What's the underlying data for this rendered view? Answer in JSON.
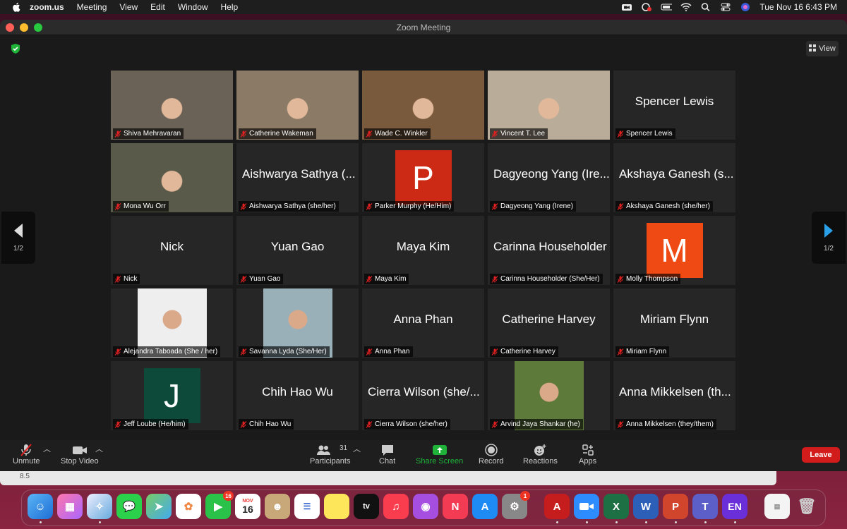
{
  "menubar": {
    "app": "zoom.us",
    "items": [
      "Meeting",
      "View",
      "Edit",
      "Window",
      "Help"
    ],
    "clock": "Tue Nov 16  6:43 PM"
  },
  "window": {
    "title": "Zoom Meeting",
    "view_label": "View",
    "page_indicator_left": "1/2",
    "page_indicator_right": "1/2"
  },
  "tiles": [
    {
      "name": "Shiva Mehravaran",
      "mode": "video",
      "scene": "room-1"
    },
    {
      "name": "Catherine Wakeman",
      "mode": "video",
      "scene": "room-2"
    },
    {
      "name": "Wade C. Winkler",
      "mode": "video",
      "scene": "room-3"
    },
    {
      "name": "Vincent T. Lee",
      "mode": "video",
      "scene": "room-4",
      "active": true
    },
    {
      "name": "Spencer Lewis",
      "display": "Spencer Lewis",
      "mode": "name"
    },
    {
      "name": "Mona Wu Orr",
      "mode": "video",
      "scene": "room-5"
    },
    {
      "name": "Aishwarya Sathya (she/her)",
      "display": "Aishwarya Sathya (...",
      "mode": "name"
    },
    {
      "name": "Parker Murphy  (He/Him)",
      "mode": "avatar",
      "initial": "P",
      "color": "#cc2a14"
    },
    {
      "name": "Dagyeong Yang (Irene)",
      "display": "Dagyeong Yang (Ire...",
      "mode": "name"
    },
    {
      "name": "Akshaya Ganesh (she/her)",
      "display": "Akshaya Ganesh (s...",
      "mode": "name"
    },
    {
      "name": "Nick",
      "display": "Nick",
      "mode": "name"
    },
    {
      "name": "Yuan Gao",
      "display": "Yuan Gao",
      "mode": "name"
    },
    {
      "name": "Maya Kim",
      "display": "Maya Kim",
      "mode": "name"
    },
    {
      "name": "Carinna Householder  (She/Her)",
      "display": "Carinna Householder",
      "mode": "name"
    },
    {
      "name": "Molly Thompson",
      "mode": "avatar",
      "initial": "M",
      "color": "#f04a14"
    },
    {
      "name": "Alejandra Taboada (She / her)",
      "mode": "photo",
      "scene": "photo-1"
    },
    {
      "name": "Savanna Lyda (She/Her)",
      "mode": "photo",
      "scene": "photo-2"
    },
    {
      "name": "Anna Phan",
      "display": "Anna Phan",
      "mode": "name"
    },
    {
      "name": "Catherine Harvey",
      "display": "Catherine Harvey",
      "mode": "name"
    },
    {
      "name": "Miriam Flynn",
      "display": "Miriam Flynn",
      "mode": "name"
    },
    {
      "name": "Jeff Loube  (He/him)",
      "mode": "avatar",
      "initial": "J",
      "color": "#0e4a3a"
    },
    {
      "name": "Chih Hao Wu",
      "display": "Chih Hao Wu",
      "mode": "name"
    },
    {
      "name": "Cierra Wilson (she/her)",
      "display": "Cierra Wilson (she/...",
      "mode": "name"
    },
    {
      "name": "Arvind Jaya Shankar  (he)",
      "mode": "photo",
      "scene": "photo-3"
    },
    {
      "name": "Anna Mikkelsen (they/them)",
      "display": "Anna Mikkelsen (th...",
      "mode": "name"
    }
  ],
  "toolbar": {
    "unmute": "Unmute",
    "stop_video": "Stop Video",
    "participants": "Participants",
    "participants_count": "31",
    "chat": "Chat",
    "share_screen": "Share Screen",
    "record": "Record",
    "reactions": "Reactions",
    "apps": "Apps",
    "leave": "Leave"
  },
  "underlying_window": {
    "text": "8.5"
  },
  "dock": {
    "calendar_month": "NOV",
    "calendar_day": "16",
    "facetime_badge": "16",
    "settings_badge": "1",
    "en_label": "EN"
  },
  "colors": {
    "accent_green": "#1fb33a",
    "leave_red": "#d21b1b",
    "active_speaker": "#b4e08a",
    "muted_red": "#e02020"
  }
}
